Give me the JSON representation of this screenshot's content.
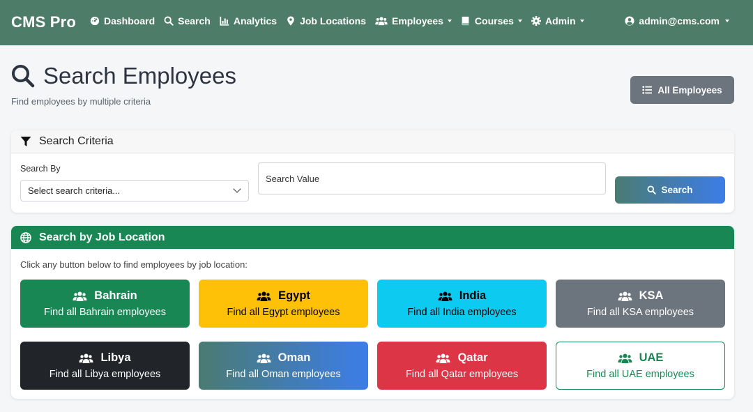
{
  "nav": {
    "brand": "CMS Pro",
    "items": [
      {
        "label": "Dashboard",
        "icon": "dashboard-icon",
        "dropdown": false
      },
      {
        "label": "Search",
        "icon": "search-icon",
        "dropdown": false
      },
      {
        "label": "Analytics",
        "icon": "chart-icon",
        "dropdown": false
      },
      {
        "label": "Job Locations",
        "icon": "map-pin-icon",
        "dropdown": false
      },
      {
        "label": "Employees",
        "icon": "users-icon",
        "dropdown": true
      },
      {
        "label": "Courses",
        "icon": "book-icon",
        "dropdown": true
      },
      {
        "label": "Admin",
        "icon": "gear-icon",
        "dropdown": true
      }
    ],
    "user": "admin@cms.com"
  },
  "header": {
    "title": "Search Employees",
    "subtitle": "Find employees by multiple criteria",
    "all_employees_label": "All Employees"
  },
  "criteria": {
    "title": "Search Criteria",
    "search_by_label": "Search By",
    "select_value": "Select search criteria...",
    "value_placeholder": "Search Value",
    "search_button": "Search"
  },
  "location": {
    "title": "Search by Job Location",
    "instructions": "Click any button below to find employees by job location:",
    "buttons": [
      {
        "name": "Bahrain",
        "desc": "Find all Bahrain employees",
        "bg": "#198754",
        "fg": "#ffffff",
        "icon": "#ffffff"
      },
      {
        "name": "Egypt",
        "desc": "Find all Egypt employees",
        "bg": "#ffc107",
        "fg": "#000000",
        "icon": "#000000"
      },
      {
        "name": "India",
        "desc": "Find all India employees",
        "bg": "#0dcaf0",
        "fg": "#000000",
        "icon": "#000000"
      },
      {
        "name": "KSA",
        "desc": "Find all KSA employees",
        "bg": "#6c757d",
        "fg": "#ffffff",
        "icon": "#ffffff"
      },
      {
        "name": "Libya",
        "desc": "Find all Libya employees",
        "bg": "#212529",
        "fg": "#ffffff",
        "icon": "#ffffff"
      },
      {
        "name": "Oman",
        "desc": "Find all Oman employees",
        "bg": "linear-gradient(90deg,#4a7b72 0%,#3c7de8 100%)",
        "fg": "#ffffff",
        "icon": "#ffffff"
      },
      {
        "name": "Qatar",
        "desc": "Find all Qatar employees",
        "bg": "#dc3545",
        "fg": "#ffffff",
        "icon": "#ffffff"
      },
      {
        "name": "UAE",
        "desc": "Find all UAE employees",
        "bg": "#ffffff",
        "fg": "#198754",
        "icon": "#198754",
        "border": "#198754"
      }
    ]
  },
  "colors": {
    "navbar": "#4d7d69",
    "success": "#198754",
    "secondary": "#6c757d"
  }
}
